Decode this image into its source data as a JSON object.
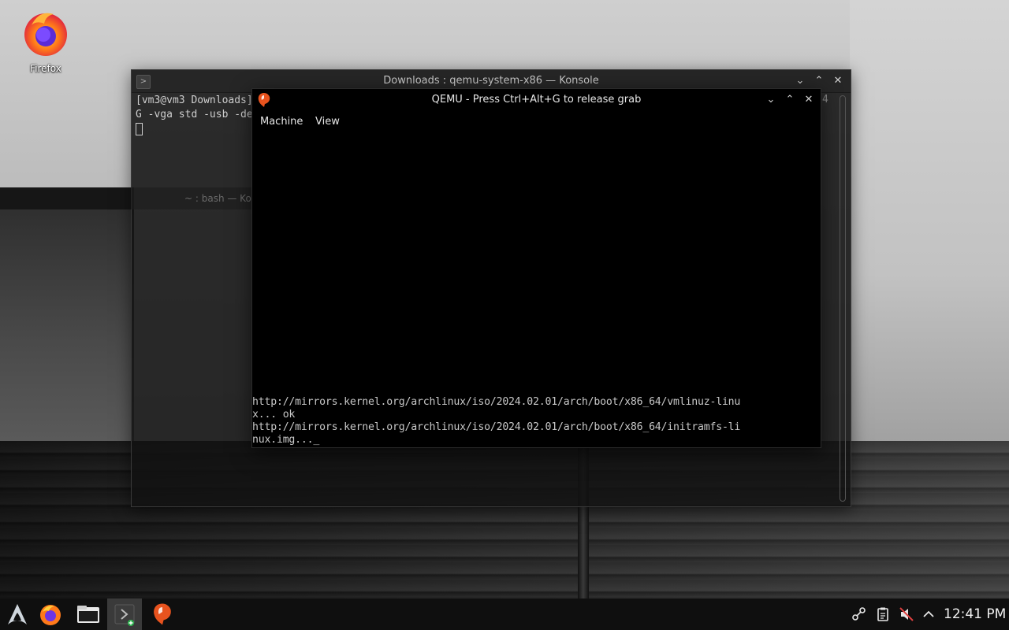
{
  "desktop": {
    "icons": [
      {
        "label": "Firefox",
        "icon": "firefox-icon"
      }
    ]
  },
  "konsole": {
    "title": "Downloads : qemu-system-x86 — Konsole",
    "lines": [
      "[vm3@vm3 Downloads]",
      "G -vga std -usb -de"
    ],
    "overflow_char": "4",
    "buttons": {
      "minimize": "⌄",
      "maximize": "⌃",
      "close": "✕"
    }
  },
  "ghost_konsole": {
    "title": "~ : bash — Ko"
  },
  "qemu": {
    "title": "QEMU - Press Ctrl+Alt+G to release grab",
    "menu": [
      "Machine",
      "View"
    ],
    "console_lines": [
      "http://mirrors.kernel.org/archlinux/iso/2024.02.01/arch/boot/x86_64/vmlinuz-linu",
      "x... ok",
      "http://mirrors.kernel.org/archlinux/iso/2024.02.01/arch/boot/x86_64/initramfs-li",
      "nux.img..._"
    ],
    "buttons": {
      "minimize": "⌄",
      "maximize": "⌃",
      "close": "✕"
    }
  },
  "taskbar": {
    "items": [
      {
        "name": "application-launcher",
        "icon": "arch-icon"
      },
      {
        "name": "firefox",
        "icon": "firefox-icon"
      },
      {
        "name": "file-manager",
        "icon": "folder-icon"
      },
      {
        "name": "konsole",
        "icon": "terminal-icon",
        "active": true
      },
      {
        "name": "qemu",
        "icon": "qemu-icon"
      }
    ],
    "tray": [
      "network-icon",
      "clipboard-icon",
      "volume-muted-icon",
      "expand-tray-icon"
    ],
    "clock": "12:41 PM"
  },
  "colors": {
    "taskbar": "#0f0f0f",
    "titlebar": "#262626",
    "qemu_bg": "#000000"
  }
}
